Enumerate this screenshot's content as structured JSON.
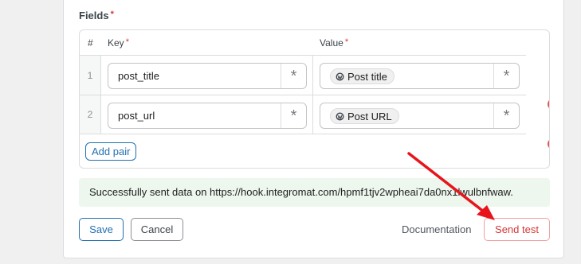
{
  "fields": {
    "label": "Fields",
    "required_mark": "*",
    "headers": {
      "num": "#",
      "key": "Key",
      "value": "Value"
    },
    "rows": [
      {
        "index": "1",
        "key": "post_title",
        "value_chip": "Post title"
      },
      {
        "index": "2",
        "key": "post_url",
        "value_chip": "Post URL"
      }
    ],
    "star_glyph": "*",
    "delete_glyph": "×",
    "add_pair_label": "Add pair"
  },
  "notice": {
    "text": "Successfully sent data on https://hook.integromat.com/hpmf1tjv2wpheai7da0nx1lwulbnfwaw."
  },
  "actions": {
    "save_label": "Save",
    "cancel_label": "Cancel",
    "documentation_label": "Documentation",
    "send_test_label": "Send test"
  },
  "colors": {
    "accent": "#2271b1",
    "danger": "#d63638",
    "success_bg": "#edf7ee",
    "annotation_arrow": "#e8141c"
  },
  "icons": {
    "chip_icon": "wordpress-icon",
    "delete_icon": "remove-circle-icon",
    "field_action_icon": "asterisk-icon"
  }
}
